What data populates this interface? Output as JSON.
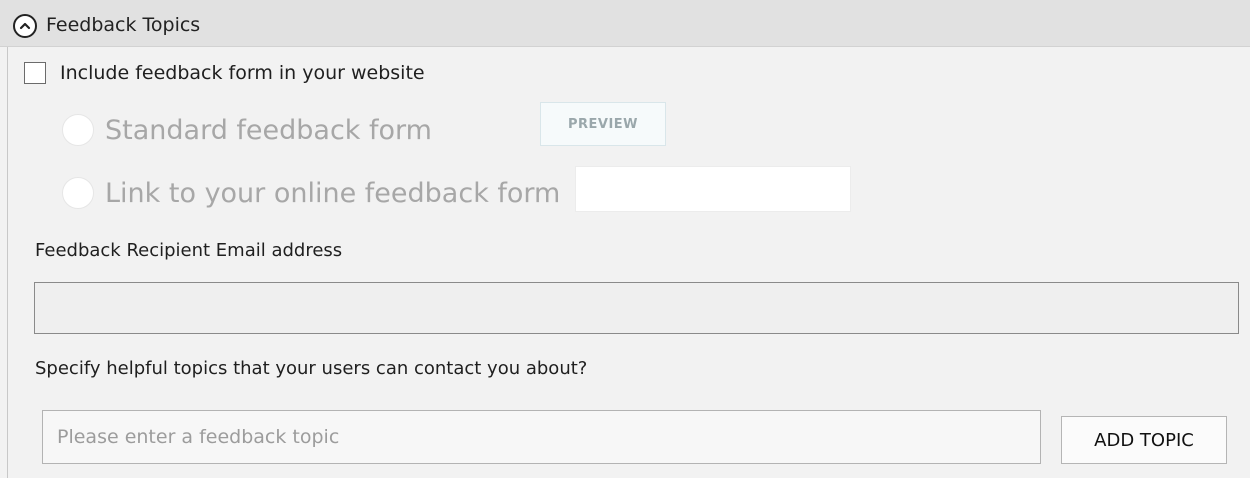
{
  "section": {
    "title": "Feedback Topics",
    "collapse_icon": "chevron-up-icon"
  },
  "include_checkbox": {
    "label": "Include feedback form in your website",
    "checked": false
  },
  "options": {
    "standard_label": "Standard feedback form",
    "preview_label": "PREVIEW",
    "link_label": "Link to your online feedback form"
  },
  "recipient": {
    "label": "Feedback Recipient Email address",
    "value": ""
  },
  "topics": {
    "label": "Specify helpful topics that your users can contact you about?",
    "placeholder": "Please enter a feedback topic",
    "add_label": "ADD TOPIC"
  },
  "colors": {
    "header_bg": "#e1e1e1",
    "panel_bg": "#f2f2f2",
    "disabled_text": "#a7a7a7"
  }
}
